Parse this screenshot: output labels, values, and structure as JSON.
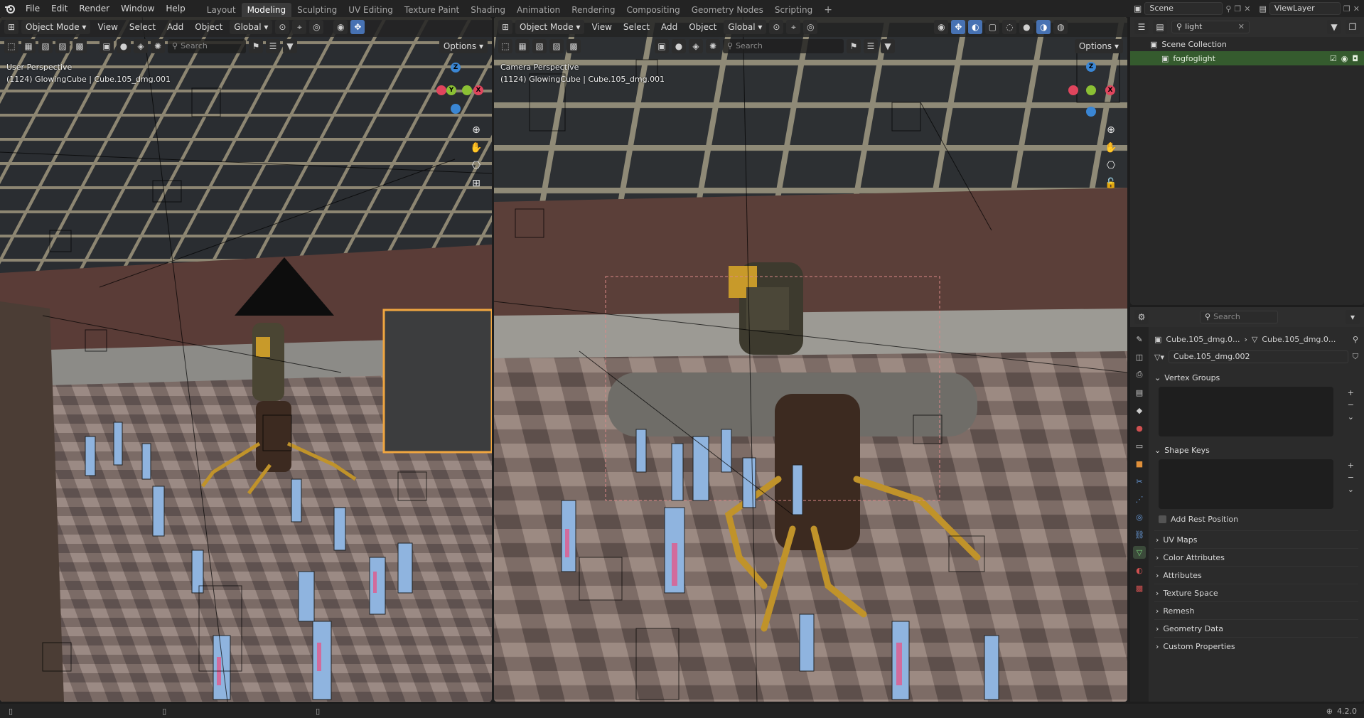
{
  "menu": [
    "File",
    "Edit",
    "Render",
    "Window",
    "Help"
  ],
  "workspaces": [
    "Layout",
    "Modeling",
    "Sculpting",
    "UV Editing",
    "Texture Paint",
    "Shading",
    "Animation",
    "Rendering",
    "Compositing",
    "Geometry Nodes",
    "Scripting"
  ],
  "active_workspace": "Modeling",
  "scene_name": "Scene",
  "view_layer_name": "ViewLayer",
  "left_view": {
    "mode": "Object Mode",
    "menus": [
      "View",
      "Select",
      "Add",
      "Object"
    ],
    "orientation": "Global",
    "search_placeholder": "Search",
    "options_label": "Options",
    "perspective_label": "User Perspective",
    "object_label": "(1124) GlowingCube | Cube.105_dmg.001"
  },
  "right_view": {
    "mode": "Object Mode",
    "menus": [
      "View",
      "Select",
      "Add",
      "Object"
    ],
    "orientation": "Global",
    "search_placeholder": "Search",
    "options_label": "Options",
    "perspective_label": "Camera Perspective",
    "object_label": "(1124) GlowingCube | Cube.105_dmg.001"
  },
  "gizmo": {
    "x": "X",
    "y": "Y",
    "z": "Z"
  },
  "outliner": {
    "filter_value": "light",
    "collection": "Scene Collection",
    "item": "fogfoglight"
  },
  "properties": {
    "search_placeholder": "Search",
    "breadcrumb_object": "Cube.105_dmg.0...",
    "breadcrumb_mesh": "Cube.105_dmg.0...",
    "mesh_name": "Cube.105_dmg.002",
    "panels": {
      "vertex_groups": "Vertex Groups",
      "shape_keys": "Shape Keys",
      "add_rest_position": "Add Rest Position",
      "uv_maps": "UV Maps",
      "color_attributes": "Color Attributes",
      "attributes": "Attributes",
      "texture_space": "Texture Space",
      "remesh": "Remesh",
      "geometry_data": "Geometry Data",
      "custom_properties": "Custom Properties"
    }
  },
  "version": "4.2.0",
  "colors": {
    "accent": "#4772b3",
    "selected_row": "#355b2e",
    "axis_x": "#e0455d",
    "axis_y": "#8bc034",
    "axis_z": "#3a86d4"
  }
}
